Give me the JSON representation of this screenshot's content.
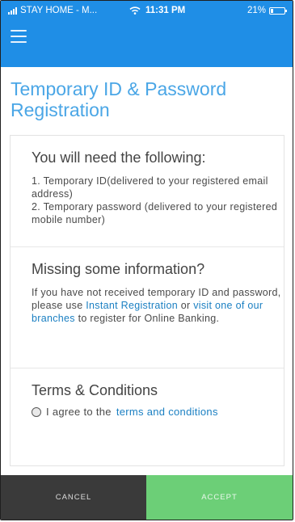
{
  "status_bar": {
    "carrier": "STAY HOME - M...",
    "time": "11:31 PM",
    "battery": "21%",
    "battery_level": 0.21
  },
  "header": {
    "menu_icon": "hamburger-icon"
  },
  "page": {
    "title": "Temporary ID & Password Registration"
  },
  "sections": {
    "requirements": {
      "title": "You will need the following:",
      "items": [
        "1. Temporary ID(delivered to your registered email address)",
        "2. Temporary password (delivered to your registered mobile number)"
      ]
    },
    "missing": {
      "title": "Missing some information?",
      "text_before": "If you have not received temporary ID and password, please use",
      "link1": "Instant Registration",
      "text_middle": "or",
      "link2": "visit one of our branches",
      "text_after": "to register for Online Banking."
    },
    "terms": {
      "title": "Terms & Conditions",
      "agree_text": "I agree to the",
      "terms_link": "terms and conditions",
      "checked": false
    }
  },
  "footer": {
    "cancel_label": "CANCEL",
    "accept_label": "ACCEPT"
  },
  "colors": {
    "header_blue": "#1f8ee6",
    "title_blue": "#4aa6e6",
    "link_blue": "#1a7fc2",
    "cancel_bg": "#3a3a3a",
    "accept_green": "#6ccf77"
  }
}
